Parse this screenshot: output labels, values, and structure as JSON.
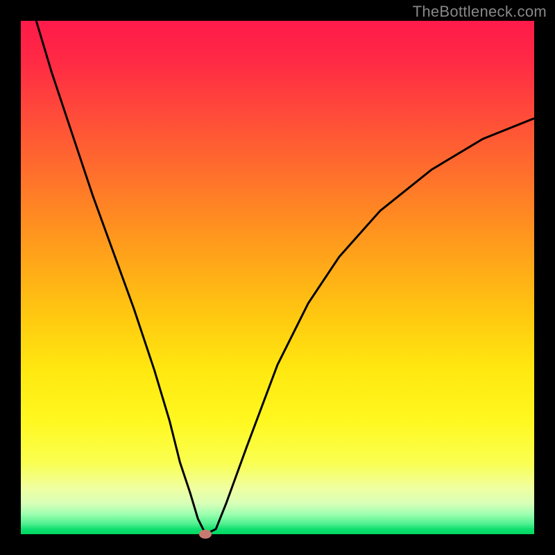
{
  "watermark": "TheBottleneck.com",
  "chart_data": {
    "type": "line",
    "title": "",
    "xlabel": "",
    "ylabel": "",
    "xlim": [
      0,
      100
    ],
    "ylim": [
      0,
      100
    ],
    "series": [
      {
        "name": "curve",
        "x": [
          3,
          6,
          10,
          14,
          18,
          22,
          26,
          29,
          31,
          33,
          34.5,
          35.5,
          36,
          38,
          40,
          44,
          50,
          56,
          62,
          70,
          80,
          90,
          100
        ],
        "y": [
          100,
          90,
          78,
          66,
          55,
          44,
          32,
          22,
          14,
          8,
          3,
          1,
          0,
          1,
          6,
          17,
          33,
          45,
          54,
          63,
          71,
          77,
          81
        ]
      }
    ],
    "marker": {
      "x": 36,
      "y": 0
    },
    "colors": {
      "gradient_top": "#ff1a4a",
      "gradient_mid": "#ffe810",
      "gradient_bottom": "#00d860",
      "curve": "#000000",
      "marker": "#c97a70",
      "frame": "#000000"
    }
  }
}
